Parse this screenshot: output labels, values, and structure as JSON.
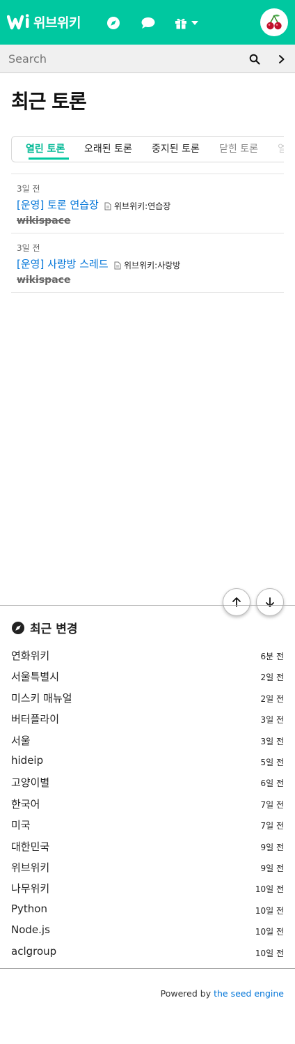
{
  "header": {
    "brand": "위브위키",
    "icons": [
      "compass-icon",
      "chat-icon",
      "gift-icon",
      "caret-down-icon"
    ],
    "avatar": "cherry-avatar",
    "accent_color": "#00c8a0"
  },
  "search": {
    "placeholder": "Search",
    "value": ""
  },
  "main": {
    "title": "최근 토론",
    "tabs": [
      {
        "label": "열린 토론",
        "active": true
      },
      {
        "label": "오래된 토론",
        "active": false
      },
      {
        "label": "중지된 토론",
        "active": false
      },
      {
        "label": "닫힌 토론",
        "active": false
      },
      {
        "label": "열린",
        "active": false
      }
    ],
    "threads": [
      {
        "time": "3일 전",
        "title": "[운영] 토론 연습장",
        "document": "위브위키:연습장",
        "user": "wikispace"
      },
      {
        "time": "3일 전",
        "title": "[운영] 사랑방 스레드",
        "document": "위브위키:사랑방",
        "user": "wikispace"
      }
    ]
  },
  "recent_changes": {
    "title": "최근 변경",
    "items": [
      {
        "name": "연화위키",
        "time": "6분 전"
      },
      {
        "name": "서울특별시",
        "time": "2일 전"
      },
      {
        "name": "미스키 매뉴얼",
        "time": "2일 전"
      },
      {
        "name": "버터플라이",
        "time": "3일 전"
      },
      {
        "name": "서울",
        "time": "3일 전"
      },
      {
        "name": "hideip",
        "time": "5일 전"
      },
      {
        "name": "고양이별",
        "time": "6일 전"
      },
      {
        "name": "한국어",
        "time": "7일 전"
      },
      {
        "name": "미국",
        "time": "7일 전"
      },
      {
        "name": "대한민국",
        "time": "9일 전"
      },
      {
        "name": "위브위키",
        "time": "9일 전"
      },
      {
        "name": "나무위키",
        "time": "10일 전"
      },
      {
        "name": "Python",
        "time": "10일 전"
      },
      {
        "name": "Node.js",
        "time": "10일 전"
      },
      {
        "name": "aclgroup",
        "time": "10일 전"
      }
    ]
  },
  "footer": {
    "prefix": "Powered by ",
    "link": "the seed engine"
  }
}
